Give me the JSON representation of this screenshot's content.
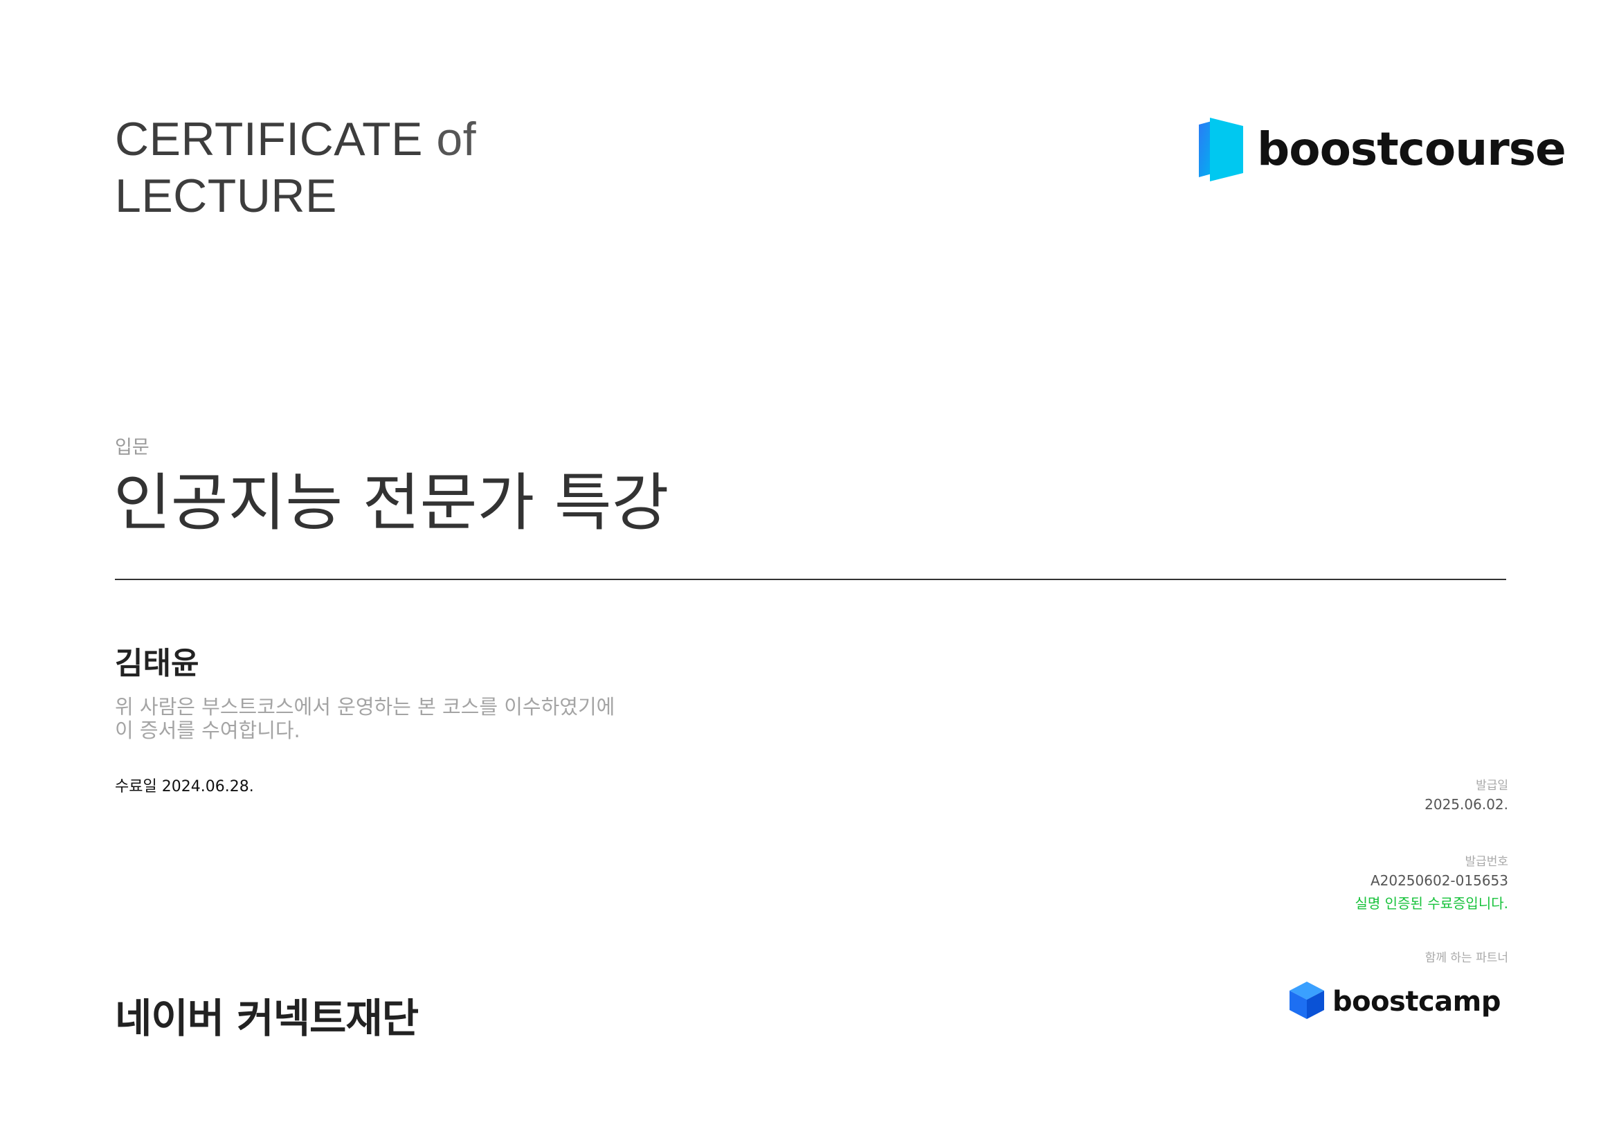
{
  "header": {
    "title_line1_main": "CERTIFICATE",
    "title_line1_of": "of",
    "title_line2": "LECTURE",
    "brand_name": "boostcourse"
  },
  "course": {
    "level": "입문",
    "name": "인공지능 전문가 특강"
  },
  "recipient": {
    "name": "김태윤",
    "description_line1": "위 사람은 부스트코스에서 운영하는 본 코스를 이수하였기에",
    "description_line2": "이 증서를 수여합니다.",
    "completion_label": "수료일",
    "completion_date": "2024.06.28."
  },
  "issue": {
    "date_label": "발급일",
    "date_value": "2025.06.02.",
    "number_label": "발급번호",
    "number_value": "A20250602-015653",
    "verified_text": "실명 인증된 수료증입니다.",
    "partner_label": "함께 하는 파트너"
  },
  "footer": {
    "foundation": "네이버 커넥트재단",
    "partner_brand": "boostcamp"
  },
  "colors": {
    "brand_cyan": "#00c8f0",
    "brand_blue": "#2a7bf5",
    "verified_green": "#17c23b",
    "divider": "#333333"
  },
  "icons": {
    "boostcourse_logo": "boostcourse-logo-icon",
    "boostcamp_logo": "boostcamp-cube-icon"
  }
}
